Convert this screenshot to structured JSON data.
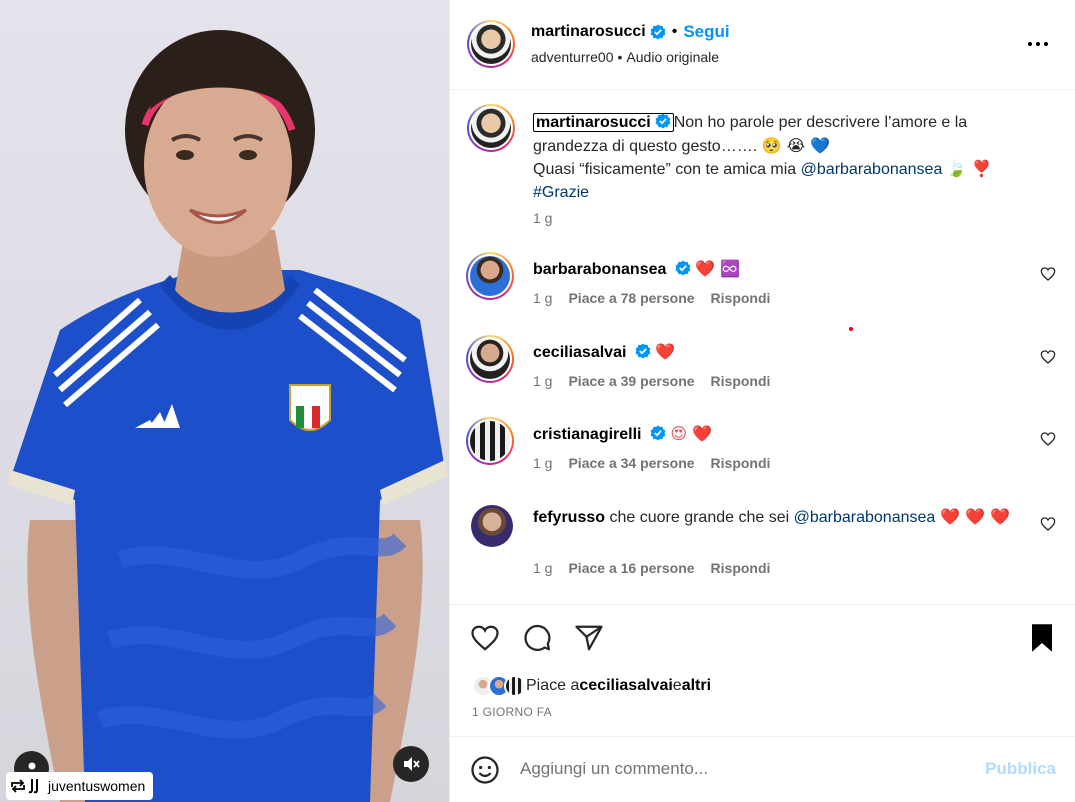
{
  "post": {
    "author": "martinarosucci",
    "follow_label": "Segui",
    "audio_owner": "adventurre00",
    "audio_label": "Audio originale",
    "repost_user": "juventuswomen"
  },
  "caption": {
    "username": "martinarosucci",
    "line1": "Non ho parole per descrivere l’amore e la grandezza di questo gesto……. ",
    "emojis1": "🥺 😭 💙",
    "line2_prefix": "Quasi “fisicamente” con te amica mia ",
    "mention": "@barbarabonansea",
    "emojis2": "🍃 ❣️",
    "hashtag": "#Grazie",
    "time": "1 g"
  },
  "comments": [
    {
      "username": "barbarabonansea",
      "text": "❤️ ♾️",
      "time": "1 g",
      "likes": "Piace a 78 persone",
      "reply": "Rispondi"
    },
    {
      "username": "ceciliasalvai",
      "text": "❤️",
      "time": "1 g",
      "likes": "Piace a 39 persone",
      "reply": "Rispondi"
    },
    {
      "username": "cristianagirelli",
      "text": "😍 ❤️",
      "time": "1 g",
      "likes": "Piace a 34 persone",
      "reply": "Rispondi"
    },
    {
      "username": "fefyrusso",
      "text_prefix": "che cuore grande che sei ",
      "mention": "@barbarabonansea",
      "text_suffix": " ❤️ ❤️ ❤️",
      "time": "1 g",
      "likes": "Piace a 16 persone",
      "reply": "Rispondi"
    }
  ],
  "likes": {
    "prefix": "Piace a ",
    "user": "ceciliasalvai",
    "middle": " e ",
    "others": "altri"
  },
  "date": "1 GIORNO FA",
  "comment_box": {
    "placeholder": "Aggiungi un commento...",
    "publish": "Pubblica"
  },
  "media": {
    "badge": "ITALIA"
  },
  "colors": {
    "accent": "#0095f6",
    "mention": "#00376b",
    "muted": "#737373",
    "heart": "#ed4956",
    "jersey": "#1c4fc9"
  }
}
